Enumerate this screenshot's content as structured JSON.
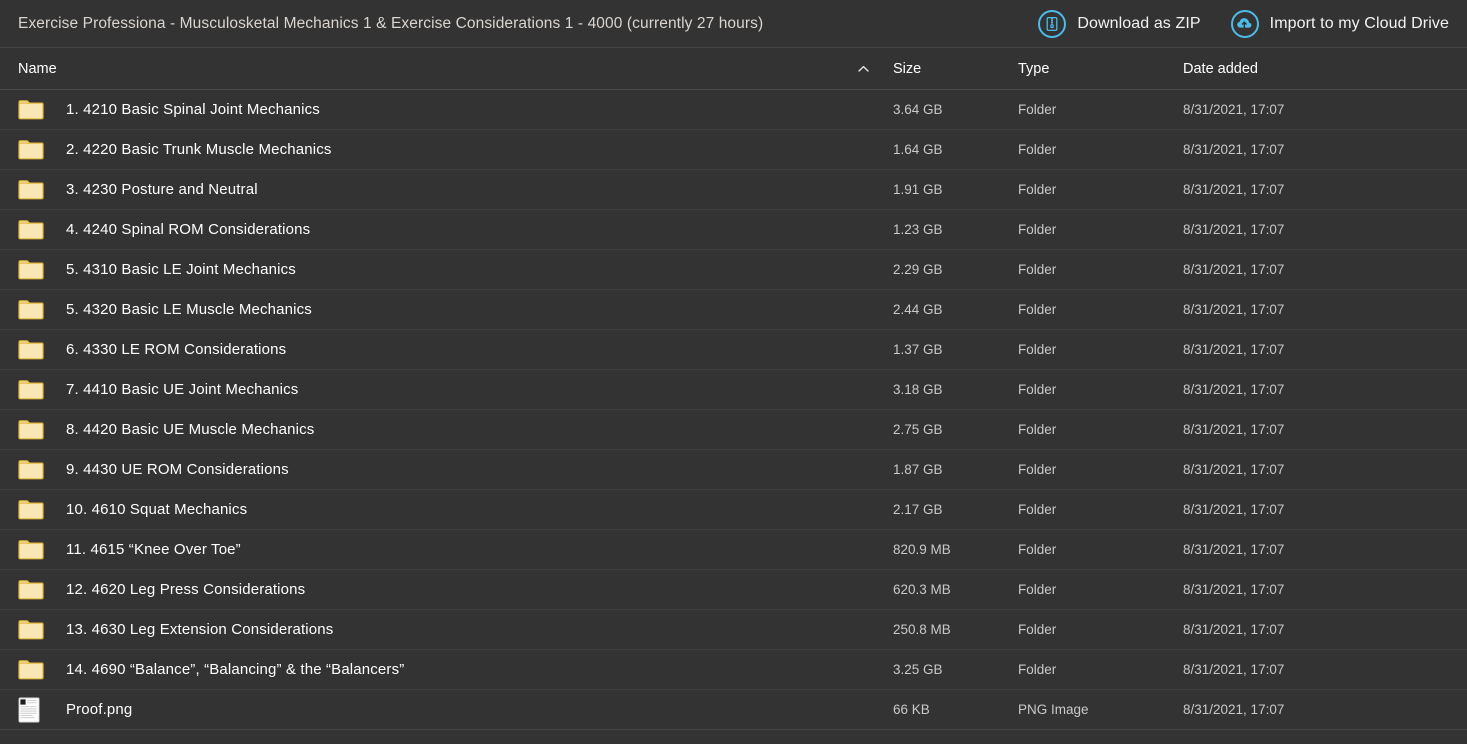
{
  "header": {
    "title": "Exercise Professiona - Musculosketal Mechanics 1 & Exercise Considerations 1 - 4000 (currently 27 hours)",
    "actions": [
      {
        "label": "Download as ZIP",
        "icon": "zip-file-icon",
        "color": "#4cbbe8"
      },
      {
        "label": "Import to my Cloud Drive",
        "icon": "cloud-upload-icon",
        "color": "#4cbbe8"
      }
    ]
  },
  "columns": {
    "name": "Name",
    "size": "Size",
    "type": "Type",
    "date": "Date added",
    "sort_icon": "chevron-up-icon",
    "sort_column": "Name",
    "sort_direction": "ascending"
  },
  "colors": {
    "background": "#333333",
    "accent": "#4cbbe8",
    "folder_fill": "#f7e3ab",
    "folder_border": "#e0b93c",
    "row_divider": "#3e3e3e",
    "title_text": "#d9d4cf"
  },
  "rows": [
    {
      "icon": "folder-icon",
      "name": "1. 4210 Basic Spinal Joint Mechanics",
      "size": "3.64 GB",
      "type": "Folder",
      "date": "8/31/2021, 17:07"
    },
    {
      "icon": "folder-icon",
      "name": "2. 4220 Basic Trunk Muscle Mechanics",
      "size": "1.64 GB",
      "type": "Folder",
      "date": "8/31/2021, 17:07"
    },
    {
      "icon": "folder-icon",
      "name": "3. 4230 Posture and Neutral",
      "size": "1.91 GB",
      "type": "Folder",
      "date": "8/31/2021, 17:07"
    },
    {
      "icon": "folder-icon",
      "name": "4. 4240 Spinal ROM Considerations",
      "size": "1.23 GB",
      "type": "Folder",
      "date": "8/31/2021, 17:07"
    },
    {
      "icon": "folder-icon",
      "name": "5. 4310 Basic LE Joint Mechanics",
      "size": "2.29 GB",
      "type": "Folder",
      "date": "8/31/2021, 17:07"
    },
    {
      "icon": "folder-icon",
      "name": "5. 4320 Basic LE Muscle Mechanics",
      "size": "2.44 GB",
      "type": "Folder",
      "date": "8/31/2021, 17:07"
    },
    {
      "icon": "folder-icon",
      "name": "6. 4330 LE ROM Considerations",
      "size": "1.37 GB",
      "type": "Folder",
      "date": "8/31/2021, 17:07"
    },
    {
      "icon": "folder-icon",
      "name": "7. 4410 Basic UE Joint Mechanics",
      "size": "3.18 GB",
      "type": "Folder",
      "date": "8/31/2021, 17:07"
    },
    {
      "icon": "folder-icon",
      "name": "8. 4420 Basic UE Muscle Mechanics",
      "size": "2.75 GB",
      "type": "Folder",
      "date": "8/31/2021, 17:07"
    },
    {
      "icon": "folder-icon",
      "name": "9. 4430 UE ROM Considerations",
      "size": "1.87 GB",
      "type": "Folder",
      "date": "8/31/2021, 17:07"
    },
    {
      "icon": "folder-icon",
      "name": "10. 4610 Squat Mechanics",
      "size": "2.17 GB",
      "type": "Folder",
      "date": "8/31/2021, 17:07"
    },
    {
      "icon": "folder-icon",
      "name": "11. 4615 “Knee Over Toe”",
      "size": "820.9 MB",
      "type": "Folder",
      "date": "8/31/2021, 17:07"
    },
    {
      "icon": "folder-icon",
      "name": "12. 4620 Leg Press Considerations",
      "size": "620.3 MB",
      "type": "Folder",
      "date": "8/31/2021, 17:07"
    },
    {
      "icon": "folder-icon",
      "name": "13. 4630 Leg Extension Considerations",
      "size": "250.8 MB",
      "type": "Folder",
      "date": "8/31/2021, 17:07"
    },
    {
      "icon": "folder-icon",
      "name": "14. 4690 “Balance”, “Balancing” & the “Balancers”",
      "size": "3.25 GB",
      "type": "Folder",
      "date": "8/31/2021, 17:07"
    },
    {
      "icon": "png-image-icon",
      "name": "Proof.png",
      "size": "66 KB",
      "type": "PNG Image",
      "date": "8/31/2021, 17:07"
    }
  ]
}
